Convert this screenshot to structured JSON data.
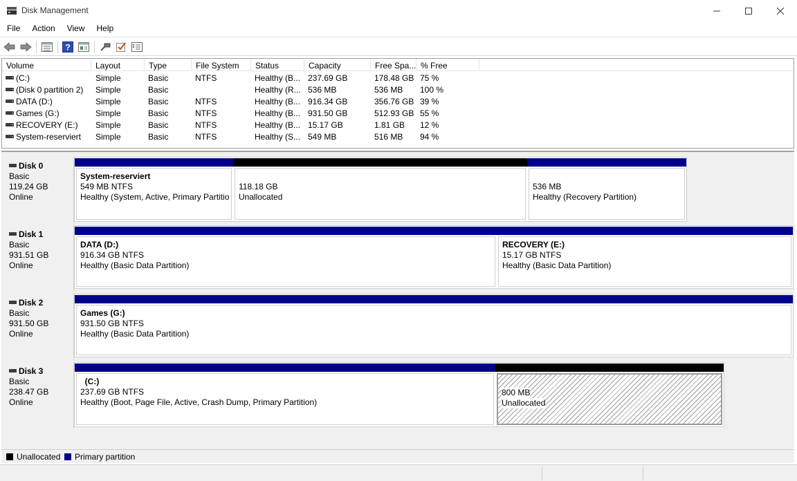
{
  "window": {
    "title": "Disk Management"
  },
  "menu": [
    "File",
    "Action",
    "View",
    "Help"
  ],
  "toolbar": {
    "icons": [
      "back-icon",
      "forward-icon",
      "properties-list-icon",
      "help-icon",
      "view-icon",
      "connect-icon",
      "check-icon",
      "settings-icon"
    ]
  },
  "volume_list": {
    "columns": [
      "Volume",
      "Layout",
      "Type",
      "File System",
      "Status",
      "Capacity",
      "Free Spa...",
      "% Free"
    ],
    "rows": [
      {
        "volume": " (C:)",
        "layout": "Simple",
        "type": "Basic",
        "fs": "NTFS",
        "status": "Healthy (B...",
        "capacity": "237.69 GB",
        "free": "178.48 GB",
        "pct": "75 %"
      },
      {
        "volume": "(Disk 0 partition 2)",
        "layout": "Simple",
        "type": "Basic",
        "fs": "",
        "status": "Healthy (R...",
        "capacity": "536 MB",
        "free": "536 MB",
        "pct": "100 %"
      },
      {
        "volume": "DATA (D:)",
        "layout": "Simple",
        "type": "Basic",
        "fs": "NTFS",
        "status": "Healthy (B...",
        "capacity": "916.34 GB",
        "free": "356.76 GB",
        "pct": "39 %"
      },
      {
        "volume": "Games (G:)",
        "layout": "Simple",
        "type": "Basic",
        "fs": "NTFS",
        "status": "Healthy (B...",
        "capacity": "931.50 GB",
        "free": "512.93 GB",
        "pct": "55 %"
      },
      {
        "volume": "RECOVERY (E:)",
        "layout": "Simple",
        "type": "Basic",
        "fs": "NTFS",
        "status": "Healthy (B...",
        "capacity": "15.17 GB",
        "free": "1.81 GB",
        "pct": "12 %"
      },
      {
        "volume": "System-reserviert",
        "layout": "Simple",
        "type": "Basic",
        "fs": "NTFS",
        "status": "Healthy (S...",
        "capacity": "549 MB",
        "free": "516 MB",
        "pct": "94 %"
      }
    ]
  },
  "disks": [
    {
      "name": "Disk 0",
      "type": "Basic",
      "size": "119.24 GB",
      "state": "Online",
      "partitions": [
        {
          "kind": "primary",
          "title": "System-reserviert",
          "line1": "549 MB NTFS",
          "line2": "Healthy (System, Active, Primary Partitio"
        },
        {
          "kind": "unallocated",
          "title": "",
          "line1": "118.18 GB",
          "line2": "Unallocated"
        },
        {
          "kind": "primary",
          "title": "",
          "line1": "536 MB",
          "line2": "Healthy (Recovery Partition)"
        }
      ]
    },
    {
      "name": "Disk 1",
      "type": "Basic",
      "size": "931.51 GB",
      "state": "Online",
      "partitions": [
        {
          "kind": "primary",
          "title": "DATA  (D:)",
          "line1": "916.34 GB NTFS",
          "line2": "Healthy (Basic Data Partition)"
        },
        {
          "kind": "primary",
          "title": "RECOVERY  (E:)",
          "line1": "15.17 GB NTFS",
          "line2": "Healthy (Basic Data Partition)"
        }
      ]
    },
    {
      "name": "Disk 2",
      "type": "Basic",
      "size": "931.50 GB",
      "state": "Online",
      "partitions": [
        {
          "kind": "primary",
          "title": "Games  (G:)",
          "line1": "931.50 GB NTFS",
          "line2": "Healthy (Basic Data Partition)"
        }
      ]
    },
    {
      "name": "Disk 3",
      "type": "Basic",
      "size": "238.47 GB",
      "state": "Online",
      "partitions": [
        {
          "kind": "primary",
          "title": "  (C:)",
          "line1": "237.69 GB NTFS",
          "line2": "Healthy (Boot, Page File, Active, Crash Dump, Primary Partition)"
        },
        {
          "kind": "unallocated",
          "title": "",
          "line1": "800 MB",
          "line2": "Unallocated"
        }
      ]
    }
  ],
  "legend": [
    {
      "label": "Unallocated",
      "color": "#000000"
    },
    {
      "label": "Primary partition",
      "color": "#00008b"
    }
  ],
  "colors": {
    "primary": "#00008b",
    "unallocated": "#000000"
  }
}
